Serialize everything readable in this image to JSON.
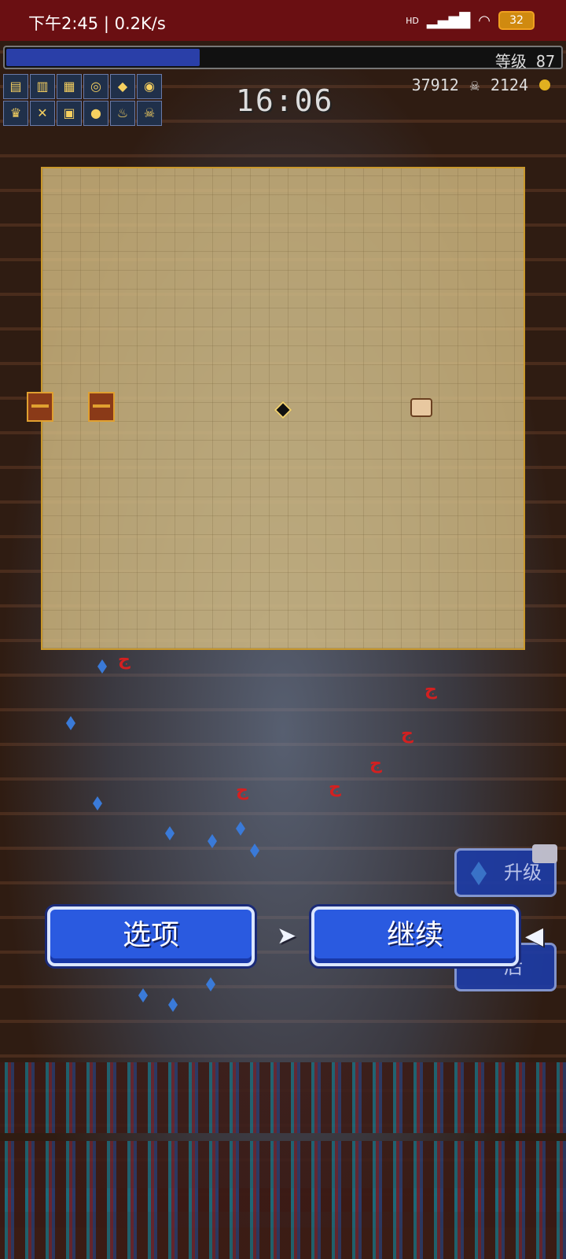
{
  "status_bar": {
    "time_speed": "下午2:45 | 0.2K/s",
    "signal": "HD",
    "battery": "32"
  },
  "hud": {
    "xp_progress": 0.35,
    "level_label": "等级 87",
    "timer": "16:06",
    "kills": "37912",
    "gold": "2124"
  },
  "inventory": {
    "weapons": [
      "book-icon",
      "scroll-icon",
      "tome-icon",
      "ring-icon",
      "orb-icon",
      "spiral-icon"
    ],
    "passives": [
      "crown-icon",
      "cross-icon",
      "tome-icon",
      "orb-icon",
      "lamp-icon",
      "skull-icon"
    ]
  },
  "overlay": {
    "options_button": "选项",
    "continue_button": "继续",
    "next_arrow": "➤",
    "prev_arrow": "◀"
  },
  "side_buttons": {
    "upgrade": "升级",
    "second_partial": "后"
  },
  "colors": {
    "status_bar": "#6a0f12",
    "xp_fill": "#2a3fa8",
    "map_bg": "#d6be84",
    "map_border": "#c9982c",
    "button_blue": "#2a5ae0"
  }
}
